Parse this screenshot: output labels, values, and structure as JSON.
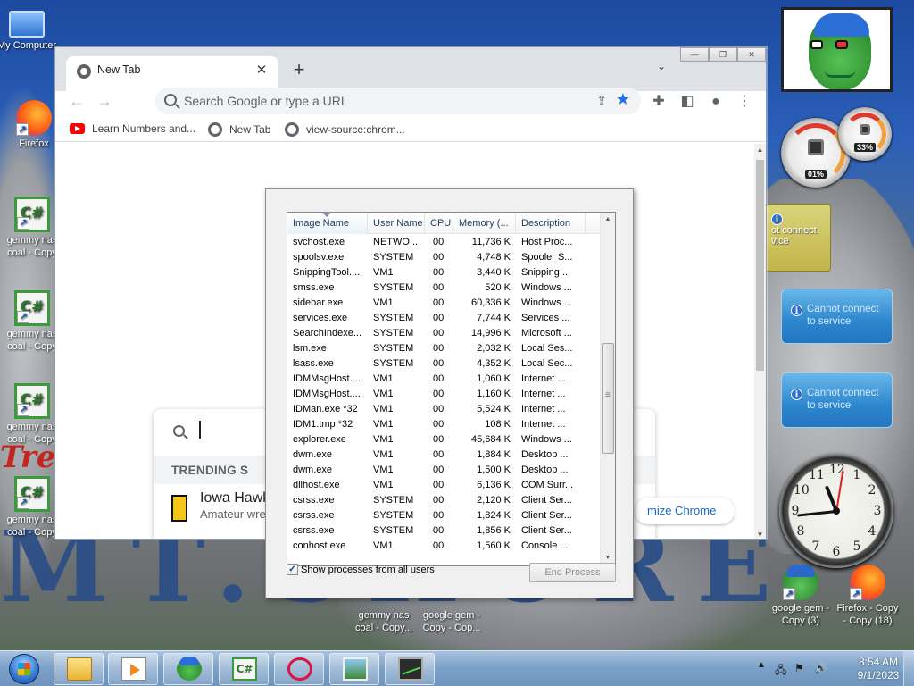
{
  "desktop": {
    "icons": [
      {
        "label": "My Computer"
      },
      {
        "label": "Firefox"
      },
      {
        "label": "gemmy nas coal - Copy"
      },
      {
        "label": "gemmy nas coal - Copy"
      },
      {
        "label": "gemmy nas coal - Copy"
      },
      {
        "label": "gemmy nas coal - Copy"
      },
      {
        "label": "gemmy nas coal - Copy..."
      },
      {
        "label": "google gem - Copy - Cop..."
      },
      {
        "label": "google gem - Copy (3)"
      },
      {
        "label": "Firefox - Copy - Copy (18)"
      }
    ],
    "wallpaper_text": "MT.SHORE",
    "wallpaper_red": "Tre"
  },
  "gadgets": {
    "cpu_meter": {
      "cpu": "01%",
      "memory": "33%"
    },
    "weather_text": "ot connect vice",
    "service_cards": [
      {
        "line1": "Cannot connect",
        "line2": "to service"
      },
      {
        "line1": "Cannot connect",
        "line2": "to service"
      }
    ],
    "clock_numbers": [
      "12",
      "1",
      "2",
      "3",
      "4",
      "5",
      "6",
      "7",
      "8",
      "9",
      "10",
      "11"
    ]
  },
  "chrome": {
    "tab_title": "New Tab",
    "omnibox_placeholder": "Search Google or type a URL",
    "bookmarks": [
      {
        "label": "Learn Numbers and..."
      },
      {
        "label": "New Tab"
      },
      {
        "label": "view-source:chrom..."
      }
    ],
    "trending_label": "TRENDING S",
    "trend_item": {
      "title": "Iowa Hawk",
      "subtitle": "Amateur wre"
    },
    "customize_label": "mize Chrome"
  },
  "taskmgr": {
    "columns": [
      "Image Name",
      "User Name",
      "CPU",
      "Memory (...",
      "Description"
    ],
    "rows": [
      [
        "svchost.exe",
        "NETWO...",
        "00",
        "11,736 K",
        "Host Proc..."
      ],
      [
        "spoolsv.exe",
        "SYSTEM",
        "00",
        "4,748 K",
        "Spooler S..."
      ],
      [
        "SnippingTool....",
        "VM1",
        "00",
        "3,440 K",
        "Snipping ..."
      ],
      [
        "smss.exe",
        "SYSTEM",
        "00",
        "520 K",
        "Windows ..."
      ],
      [
        "sidebar.exe",
        "VM1",
        "00",
        "60,336 K",
        "Windows ..."
      ],
      [
        "services.exe",
        "SYSTEM",
        "00",
        "7,744 K",
        "Services ..."
      ],
      [
        "SearchIndexe...",
        "SYSTEM",
        "00",
        "14,996 K",
        "Microsoft ..."
      ],
      [
        "lsm.exe",
        "SYSTEM",
        "00",
        "2,032 K",
        "Local Ses..."
      ],
      [
        "lsass.exe",
        "SYSTEM",
        "00",
        "4,352 K",
        "Local Sec..."
      ],
      [
        "IDMMsgHost....",
        "VM1",
        "00",
        "1,060 K",
        "Internet ..."
      ],
      [
        "IDMMsgHost....",
        "VM1",
        "00",
        "1,160 K",
        "Internet ..."
      ],
      [
        "IDMan.exe *32",
        "VM1",
        "00",
        "5,524 K",
        "Internet ..."
      ],
      [
        "IDM1.tmp *32",
        "VM1",
        "00",
        "108 K",
        "Internet ..."
      ],
      [
        "explorer.exe",
        "VM1",
        "00",
        "45,684 K",
        "Windows ..."
      ],
      [
        "dwm.exe",
        "VM1",
        "00",
        "1,884 K",
        "Desktop ..."
      ],
      [
        "dwm.exe",
        "VM1",
        "00",
        "1,500 K",
        "Desktop ..."
      ],
      [
        "dllhost.exe",
        "VM1",
        "00",
        "6,136 K",
        "COM Surr..."
      ],
      [
        "csrss.exe",
        "SYSTEM",
        "00",
        "2,120 K",
        "Client Ser..."
      ],
      [
        "csrss.exe",
        "SYSTEM",
        "00",
        "1,824 K",
        "Client Ser..."
      ],
      [
        "csrss.exe",
        "SYSTEM",
        "00",
        "1,856 K",
        "Client Ser..."
      ],
      [
        "conhost.exe",
        "VM1",
        "00",
        "1,560 K",
        "Console ..."
      ]
    ],
    "show_all_label": "Show processes from all users",
    "show_all_checked": true,
    "end_process_label": "End Process"
  },
  "taskbar": {
    "time": "8:54 AM",
    "date": "9/1/2023"
  }
}
